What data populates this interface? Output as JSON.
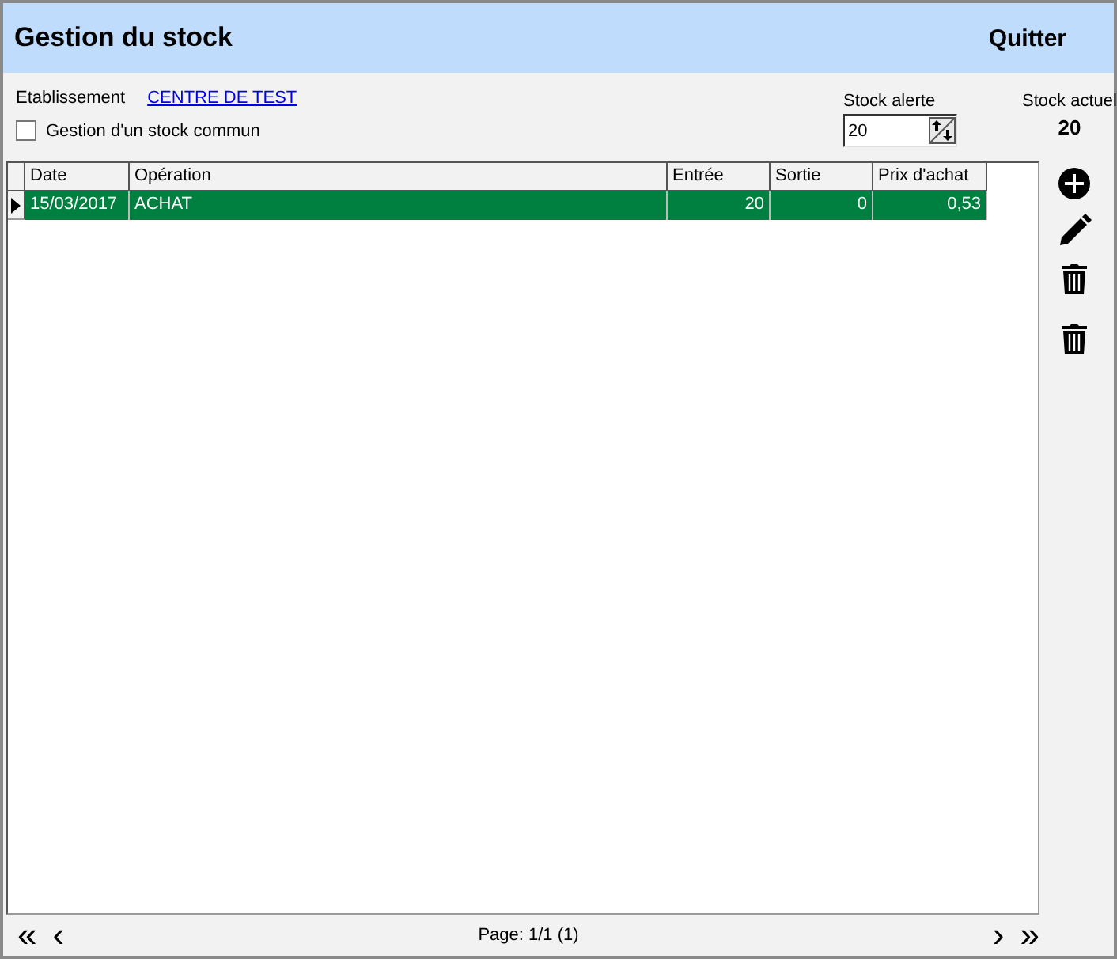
{
  "window": {
    "title": "Gestion du stock",
    "quit_button": "Quitter"
  },
  "establishment": {
    "label": "Etablissement",
    "value": "CENTRE DE TEST"
  },
  "common_stock": {
    "label": "Gestion d'un stock commun",
    "checked": false
  },
  "alert_stock": {
    "label": "Stock alerte",
    "value": "20"
  },
  "current_stock": {
    "label": "Stock actuel",
    "value": "20"
  },
  "table": {
    "columns": [
      "Date",
      "Opération",
      "Entrée",
      "Sortie",
      "Prix d'achat"
    ],
    "rows": [
      {
        "cells": [
          "15/03/2017",
          "ACHAT",
          "20",
          "0",
          "0,53"
        ],
        "selected": true
      }
    ]
  },
  "pager": {
    "first": "«",
    "previous": "‹",
    "label": "Page: 1/1 (1)",
    "next": "›",
    "last": "»"
  }
}
